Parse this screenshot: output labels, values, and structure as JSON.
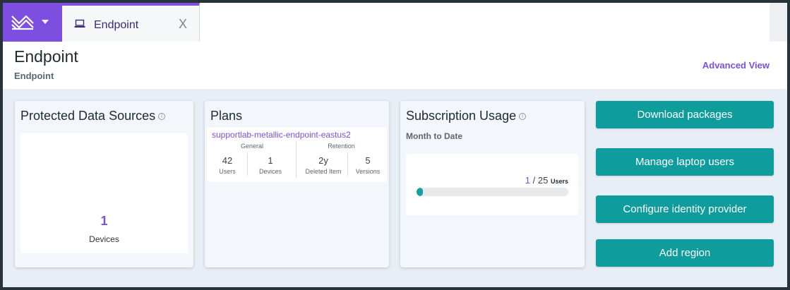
{
  "tab": {
    "label": "Endpoint",
    "close": "X"
  },
  "header": {
    "title": "Endpoint",
    "subtitle": "Endpoint",
    "advanced_view": "Advanced View"
  },
  "protected_sources": {
    "title": "Protected Data Sources",
    "info": "i",
    "value": "1",
    "label": "Devices"
  },
  "plans": {
    "title": "Plans",
    "plan_name": "supportlab-metallic-endpoint-eastus2",
    "general_label": "General",
    "retention_label": "Retention",
    "stats": [
      {
        "value": "42",
        "label": "Users"
      },
      {
        "value": "1",
        "label": "Devices"
      },
      {
        "value": "2y",
        "label": "Deleted Item"
      },
      {
        "value": "5",
        "label": "Versions"
      }
    ]
  },
  "subscription": {
    "title": "Subscription Usage",
    "info": "i",
    "caption": "Month to Date",
    "used": "1",
    "separator": "/",
    "total": "25",
    "unit": "Users",
    "progress_fraction": 0.04
  },
  "actions": [
    {
      "label": "Download packages"
    },
    {
      "label": "Manage laptop users"
    },
    {
      "label": "Configure identity provider"
    },
    {
      "label": "Add region"
    }
  ],
  "colors": {
    "brand": "#7e4ee0",
    "accent": "#0e9c9c"
  },
  "icons": {
    "logo": "metallic-logo-icon",
    "tab": "laptop-icon",
    "dropdown": "caret-down-icon"
  }
}
